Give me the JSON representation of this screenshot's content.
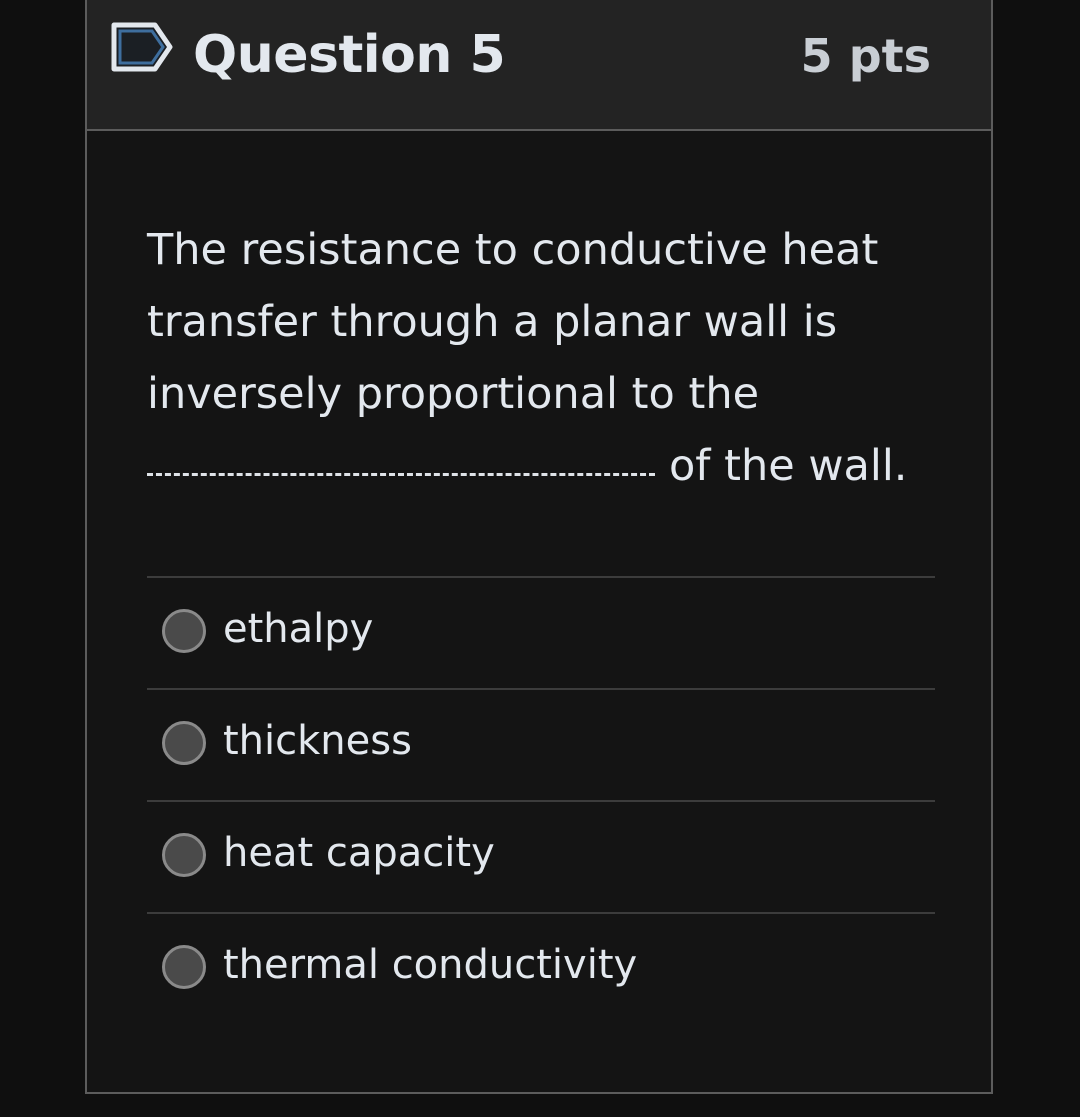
{
  "question": {
    "title": "Question 5",
    "points": "5 pts",
    "flag_icon": "bookmark-flag-icon",
    "text_lines": [
      "The resistance to conductive heat",
      "transfer through a planar wall is",
      "inversely proportional to the"
    ],
    "text_blank": "________________________",
    "text_after_blank": "of the wall."
  },
  "answers": [
    {
      "label": "ethalpy",
      "selected": false
    },
    {
      "label": "thickness",
      "selected": false
    },
    {
      "label": "heat capacity",
      "selected": false
    },
    {
      "label": "thermal conductivity",
      "selected": false
    }
  ],
  "colors": {
    "background": "#0f0f0f",
    "card_body": "#141414",
    "card_header": "#232323",
    "border": "#5c5c5c",
    "text": "#e3e8ee",
    "flag_accent": "#3e6e9e"
  }
}
